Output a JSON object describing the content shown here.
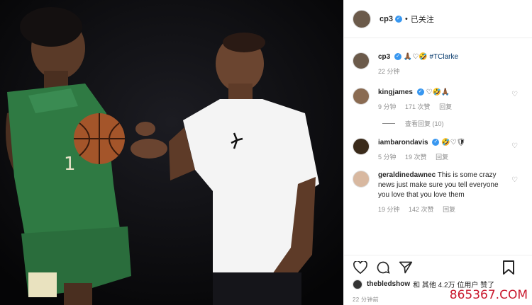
{
  "post": {
    "username": "cp3",
    "dot": "•",
    "follow_status": "已关注"
  },
  "caption": {
    "username": "cp3",
    "emojis": "🙏🏾♡🤣",
    "tag": "#TClarke",
    "time": "22 分钟"
  },
  "comments": [
    {
      "username": "kingjames",
      "verified": true,
      "text": "♡🤣🙏🏾",
      "time": "9 分钟",
      "likes": "171 次赞",
      "reply": "回复",
      "view_replies": "查看回复 (10)"
    },
    {
      "username": "iambarondavis",
      "verified": true,
      "text": "🤣♡🛡",
      "time": "5 分钟",
      "likes": "19 次赞",
      "reply": "回复"
    },
    {
      "username": "geraldinedawnec",
      "verified": false,
      "text": "This is some crazy news just make sure you tell everyone you love that you love them",
      "time": "19 分钟",
      "likes": "142 次赞",
      "reply": "回复"
    }
  ],
  "likes_line": {
    "user": "thebledshow",
    "rest": "和 其他 4.2万 位用户 赞了"
  },
  "post_time": "22 分钟前",
  "watermark": "865367.COM",
  "colors": {
    "verified": "#3897f0",
    "watermark": "#c9192e",
    "jersey": "#2f7a43"
  }
}
